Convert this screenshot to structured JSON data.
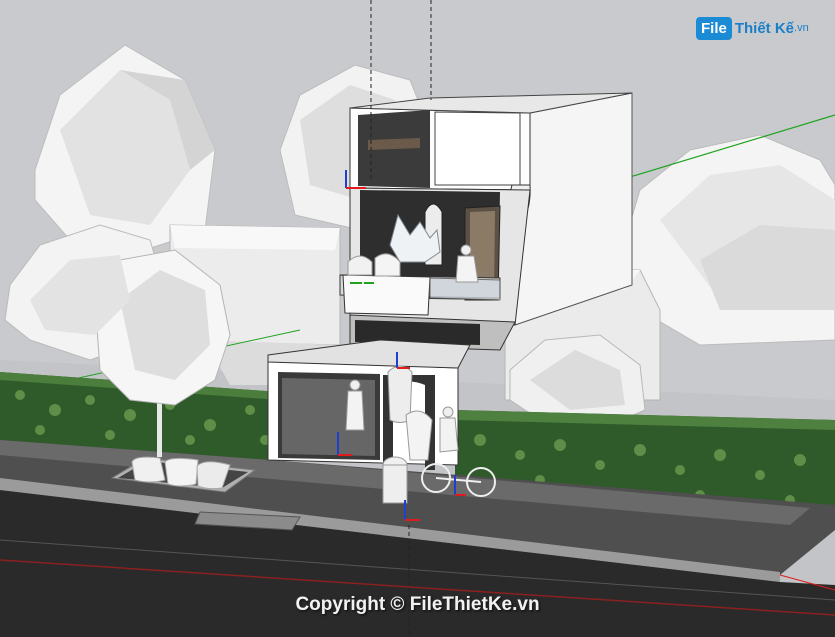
{
  "watermark": {
    "logo_file": "File",
    "logo_rest": "Thiết Kế",
    "logo_tld": ".vn"
  },
  "footer": {
    "copyright": "Copyright © FileThietKe.vn"
  },
  "colors": {
    "sky": "#c9cbce",
    "ground": "#bfc2c5",
    "road": "#2d2d2d",
    "sidewalk": "#5a5a5a",
    "hedge": "#2f5a2a",
    "building": "#ffffff",
    "axis_red": "#e01b1b",
    "axis_green": "#1fa31f",
    "axis_blue": "#1f3fd0",
    "logo_blue": "#1b8bd6"
  }
}
